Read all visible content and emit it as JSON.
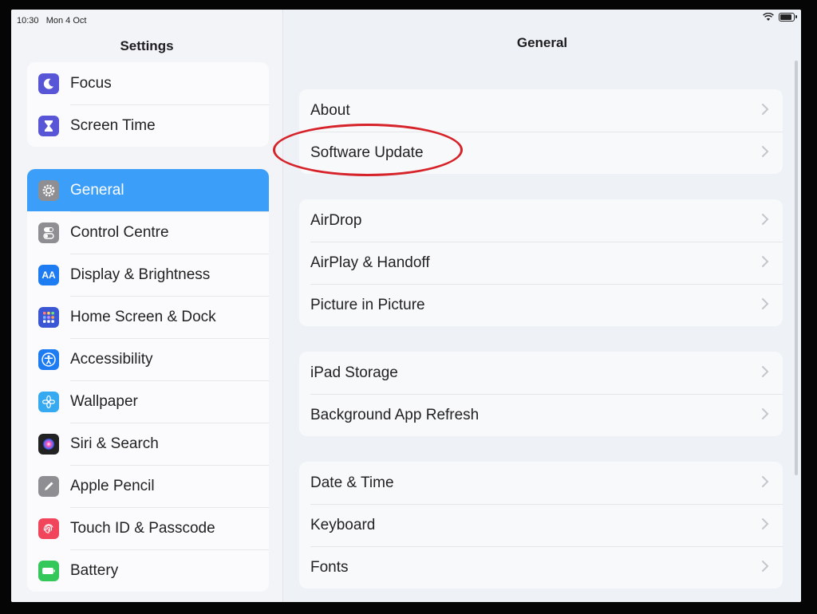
{
  "status_bar": {
    "time": "10:30",
    "date": "Mon 4 Oct"
  },
  "sidebar": {
    "title": "Settings",
    "group1": [
      {
        "label": "Focus",
        "icon": "moon-icon",
        "color": "#5856d6"
      },
      {
        "label": "Screen Time",
        "icon": "hourglass-icon",
        "color": "#5856d6"
      }
    ],
    "group2": [
      {
        "label": "General",
        "icon": "gear-icon",
        "color": "#8e8e93",
        "selected": true
      },
      {
        "label": "Control Centre",
        "icon": "toggles-icon",
        "color": "#8e8e93"
      },
      {
        "label": "Display & Brightness",
        "icon": "text-size-icon",
        "glyph": "AA",
        "color": "#1e7cf2"
      },
      {
        "label": "Home Screen & Dock",
        "icon": "app-grid-icon",
        "color": "#3a56d4"
      },
      {
        "label": "Accessibility",
        "icon": "accessibility-icon",
        "color": "#1e7cf2"
      },
      {
        "label": "Wallpaper",
        "icon": "flower-icon",
        "color": "#35aaf0"
      },
      {
        "label": "Siri & Search",
        "icon": "siri-icon",
        "color": "#222222"
      },
      {
        "label": "Apple Pencil",
        "icon": "pencil-icon",
        "color": "#8e8e93"
      },
      {
        "label": "Touch ID & Passcode",
        "icon": "fingerprint-icon",
        "color": "#f0455a"
      },
      {
        "label": "Battery",
        "icon": "battery-icon",
        "color": "#34c759"
      }
    ]
  },
  "main": {
    "title": "General",
    "groups": [
      [
        "About",
        "Software Update"
      ],
      [
        "AirDrop",
        "AirPlay & Handoff",
        "Picture in Picture"
      ],
      [
        "iPad Storage",
        "Background App Refresh"
      ],
      [
        "Date & Time",
        "Keyboard",
        "Fonts"
      ]
    ]
  },
  "colors": {
    "accent": "#3b9ef8",
    "annotation": "#d6232a"
  }
}
